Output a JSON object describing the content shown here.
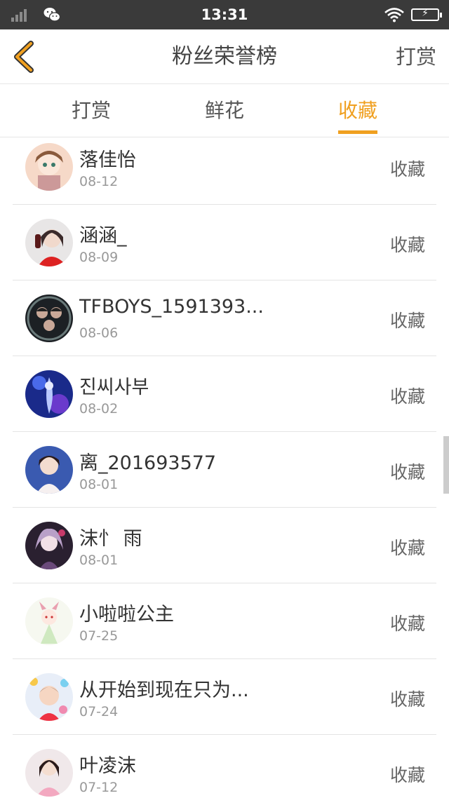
{
  "status_bar": {
    "time": "13:31",
    "icons": [
      "signal-icon",
      "wechat-icon",
      "wifi-icon",
      "battery-charging-icon"
    ]
  },
  "header": {
    "title": "粉丝荣誉榜",
    "right_action": "打赏",
    "back_icon": "chevron-left-icon",
    "back_color": "#f0a020"
  },
  "tabs": [
    {
      "label": "打赏",
      "active": false
    },
    {
      "label": "鲜花",
      "active": false
    },
    {
      "label": "收藏",
      "active": true
    }
  ],
  "accent_color": "#f0a020",
  "list": [
    {
      "name": "落佳怡",
      "date": "08-12",
      "action": "收藏"
    },
    {
      "name": "涵涵_",
      "date": "08-09",
      "action": "收藏"
    },
    {
      "name": "TFBOYS_1591393...",
      "date": "08-06",
      "action": "收藏"
    },
    {
      "name": "진씨사부",
      "date": "08-02",
      "action": "收藏"
    },
    {
      "name": "离_201693577",
      "date": "08-01",
      "action": "收藏"
    },
    {
      "name": "沫忄 雨",
      "date": "08-01",
      "action": "收藏"
    },
    {
      "name": "小啦啦公主",
      "date": "07-25",
      "action": "收藏"
    },
    {
      "name": "从开始到现在只为...",
      "date": "07-24",
      "action": "收藏"
    },
    {
      "name": "叶凌沫",
      "date": "07-12",
      "action": "收藏"
    }
  ]
}
